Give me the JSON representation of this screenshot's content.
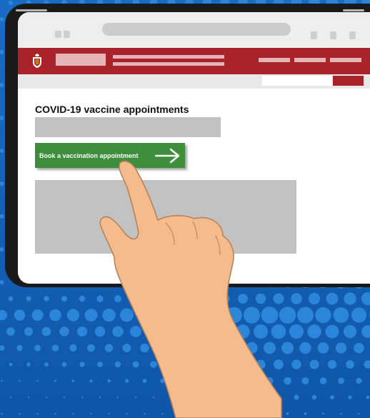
{
  "page": {
    "title": "COVID-19 vaccine appointments",
    "book_button_label": "Book a vaccination appointment"
  },
  "icons": {
    "crest": "jersey-crest-icon",
    "arrow": "arrow-right-icon",
    "hand": "pointing-hand"
  },
  "colors": {
    "background_blue": "#1862b8",
    "header_red": "#a8232a",
    "button_green": "#3d8f3b",
    "placeholder_grey": "#c2c2c2",
    "skin": "#f5bb8d"
  }
}
